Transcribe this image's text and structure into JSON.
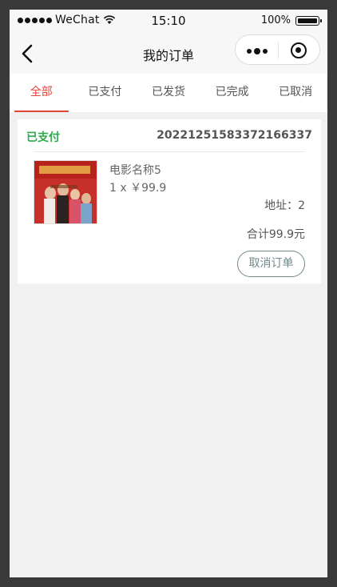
{
  "statusbar": {
    "carrier": "WeChat",
    "time": "15:10",
    "battery": "100%"
  },
  "nav": {
    "title": "我的订单"
  },
  "tabs": [
    {
      "label": "全部",
      "active": true
    },
    {
      "label": "已支付",
      "active": false
    },
    {
      "label": "已发货",
      "active": false
    },
    {
      "label": "已完成",
      "active": false
    },
    {
      "label": "已取消",
      "active": false
    }
  ],
  "orders": [
    {
      "status": "已支付",
      "order_no": "20221251583372166337",
      "product": {
        "name": "电影名称5",
        "qty_price": "1 x ￥99.9"
      },
      "address": "地址：2",
      "total": "合计99.9元",
      "action": "取消订单"
    }
  ],
  "colors": {
    "accent": "#e0453a",
    "status_green": "#2fa84f",
    "button_border": "#6f8a8a"
  },
  "icons": [
    "wifi-icon",
    "battery-icon",
    "back-arrow-icon",
    "more-dots-icon",
    "mini-program-close-icon"
  ]
}
